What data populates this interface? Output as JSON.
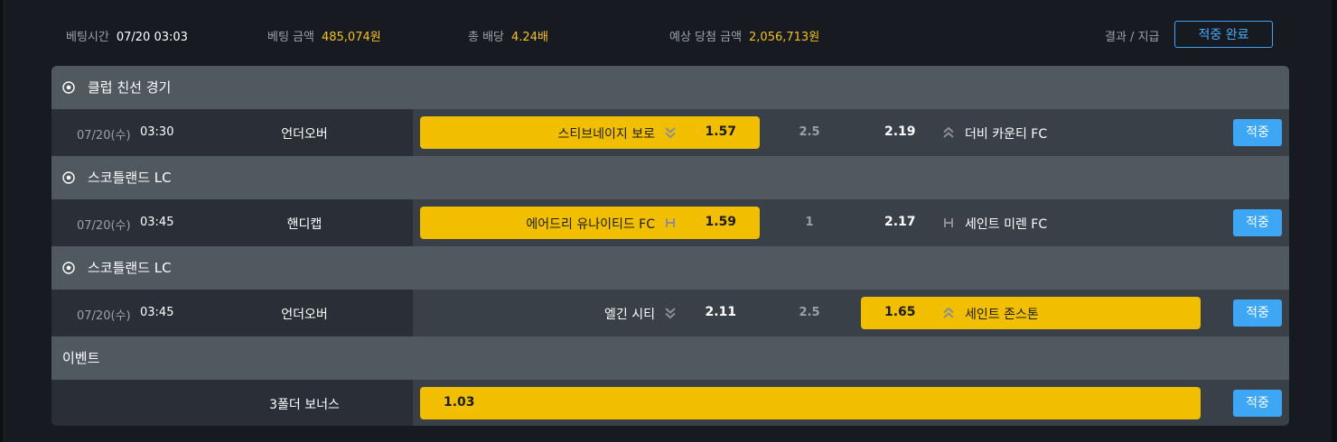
{
  "summary": {
    "bet_time_label": "베팅시간",
    "bet_time_value": "07/20 03:03",
    "bet_amount_label": "베팅 금액",
    "bet_amount_value": "485,074원",
    "total_odds_label": "총 배당",
    "total_odds_value": "4.24배",
    "expected_win_label": "예상 당첨 금액",
    "expected_win_value": "2,056,713원",
    "result_label": "결과 / 지급",
    "result_button": "적중 완료"
  },
  "colors": {
    "accent_gold": "#f1bf00",
    "accent_blue": "#3da7f5",
    "section_bg": "#505860",
    "row_bg": "#2a2f37"
  },
  "bets": [
    {
      "league": "클럽 친선 경기",
      "league_icon": "soccer-ball-icon",
      "date": "07/20(수)",
      "time": "03:30",
      "market": "언더오버",
      "home_name": "스티브네이지 보로",
      "home_icon": "double-chevron-down-icon",
      "home_odds": "1.57",
      "line": "2.5",
      "away_odds": "2.19",
      "away_icon": "double-chevron-up-icon",
      "away_name": "더비 카운티 FC",
      "selected": "home",
      "status": "적중"
    },
    {
      "league": "스코틀랜드 LC",
      "league_icon": "soccer-ball-icon",
      "date": "07/20(수)",
      "time": "03:45",
      "market": "핸디캡",
      "home_name": "에어드리 유나이티드 FC",
      "home_icon": "handicap-h-icon",
      "home_odds": "1.59",
      "line": "1",
      "away_odds": "2.17",
      "away_icon": "handicap-h-icon",
      "away_name": "세인트 미렌 FC",
      "selected": "home",
      "status": "적중"
    },
    {
      "league": "스코틀랜드 LC",
      "league_icon": "soccer-ball-icon",
      "date": "07/20(수)",
      "time": "03:45",
      "market": "언더오버",
      "home_name": "엘긴 시티",
      "home_icon": "double-chevron-down-icon",
      "home_odds": "2.11",
      "line": "2.5",
      "away_odds": "1.65",
      "away_icon": "double-chevron-up-icon",
      "away_name": "세인트 존스톤",
      "selected": "away",
      "status": "적중"
    }
  ],
  "event": {
    "title": "이벤트",
    "market": "3폴더 보너스",
    "odds": "1.03",
    "status": "적중"
  }
}
